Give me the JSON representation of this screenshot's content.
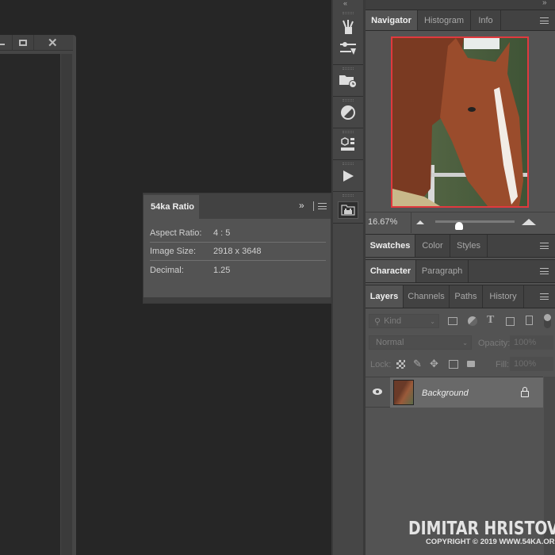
{
  "document_window": {
    "icons": [
      "minimize-icon",
      "maximize-icon",
      "close-icon"
    ]
  },
  "ratio_panel": {
    "tab": "54ka Ratio",
    "rows": [
      {
        "label": "Aspect Ratio:",
        "value": "4 : 5"
      },
      {
        "label": "Image Size:",
        "value": "2918 x 3648"
      },
      {
        "label": "Decimal:",
        "value": "1.25"
      }
    ]
  },
  "toolbar": {
    "icons": [
      "brushes-icon",
      "brush-settings-icon",
      "history-folder-icon",
      "adjustments-icon",
      "3d-icon",
      "play-actions-icon",
      "libraries-icon"
    ]
  },
  "navigator": {
    "tabs": [
      "Navigator",
      "Histogram",
      "Info"
    ],
    "zoom": "16.67%",
    "zoom_slider_percent": 30,
    "view_box_color": "#e0393e"
  },
  "swatches": {
    "tabs": [
      "Swatches",
      "Color",
      "Styles"
    ]
  },
  "character": {
    "tabs": [
      "Character",
      "Paragraph"
    ]
  },
  "layers": {
    "tabs": [
      "Layers",
      "Channels",
      "Paths",
      "History"
    ],
    "filter_placeholder": "Kind",
    "blend_mode": "Normal",
    "opacity_label": "Opacity:",
    "opacity": "100%",
    "lock_label": "Lock:",
    "fill_label": "Fill:",
    "fill": "100%",
    "items": [
      {
        "name": "Background",
        "visible": true,
        "locked": true
      }
    ]
  },
  "watermark": {
    "name": "DIMITAR HRISTOV",
    "copyright": "COPYRIGHT © 2019 WWW.54KA.ORG"
  }
}
